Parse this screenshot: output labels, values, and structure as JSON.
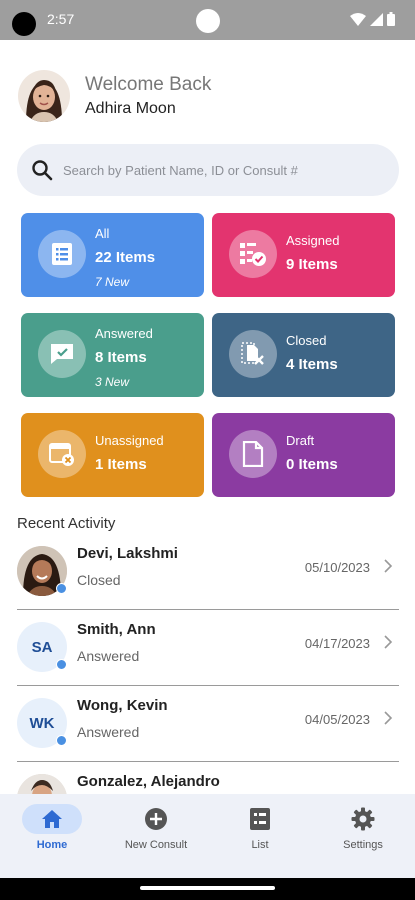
{
  "status_bar": {
    "time": "2:57"
  },
  "header": {
    "welcome": "Welcome Back",
    "user_name": "Adhira Moon"
  },
  "search": {
    "placeholder": "Search by Patient Name, ID or Consult #"
  },
  "cards": [
    {
      "label": "All",
      "count": "22 Items",
      "new": "7 New",
      "color": "#4f8fe8",
      "icon": "list-icon"
    },
    {
      "label": "Assigned",
      "count": "9 Items",
      "color": "#e3346f",
      "icon": "assigned-checklist-icon"
    },
    {
      "label": "Answered",
      "count": "8 Items",
      "new": "3 New",
      "color": "#4a9e8c",
      "icon": "message-check-icon"
    },
    {
      "label": "Closed",
      "count": "4 Items",
      "color": "#3e6586",
      "icon": "closed-document-icon"
    },
    {
      "label": "Unassigned",
      "count": "1 Items",
      "color": "#e0901d",
      "icon": "unassigned-calendar-icon"
    },
    {
      "label": "Draft",
      "count": "0 Items",
      "color": "#8b3ba1",
      "icon": "draft-document-icon"
    }
  ],
  "recent_activity": {
    "title": "Recent Activity",
    "items": [
      {
        "name": "Devi, Lakshmi",
        "status": "Closed",
        "date": "05/10/2023"
      },
      {
        "name": "Smith, Ann",
        "initials": "SA",
        "status": "Answered",
        "date": "04/17/2023"
      },
      {
        "name": "Wong, Kevin",
        "initials": "WK",
        "status": "Answered",
        "date": "04/05/2023"
      },
      {
        "name": "Gonzalez, Alejandro"
      }
    ]
  },
  "nav": [
    {
      "label": "Home",
      "icon": "home-icon",
      "active": true
    },
    {
      "label": "New Consult",
      "icon": "add-circle-icon"
    },
    {
      "label": "List",
      "icon": "list-icon"
    },
    {
      "label": "Settings",
      "icon": "gear-icon"
    }
  ]
}
